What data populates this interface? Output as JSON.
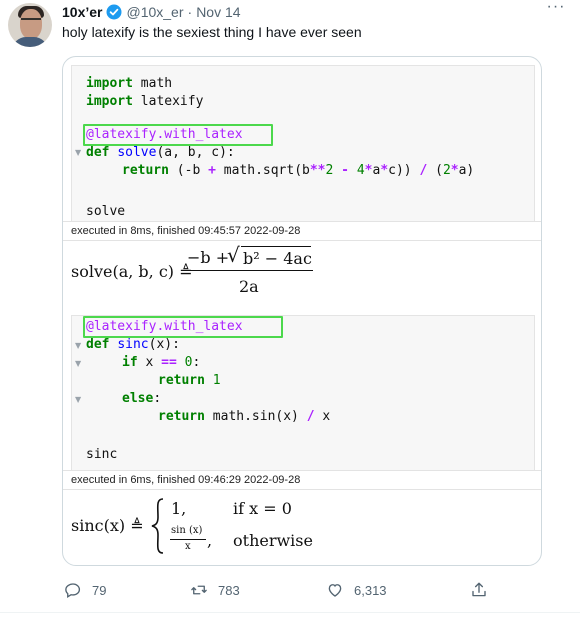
{
  "tweet": {
    "author_name": "10x’er",
    "author_handle": "@10x_er",
    "separator": "·",
    "date": "Nov 14",
    "more_label": "···",
    "text": "holy latexify is the sexiest thing I have ever seen"
  },
  "media": {
    "cell1": {
      "line1_kw": "import",
      "line1_rest": " math",
      "line2_kw": "import",
      "line2_rest": " latexify",
      "decorator": "@latexify.with_latex",
      "def_kw": "def",
      "def_name": "solve",
      "def_rest": "(a, b, c):",
      "return_kw": "return",
      "ret_p1": " (-b ",
      "ret_op1": "+",
      "ret_p2": " math.sqrt(b",
      "ret_op2": "**",
      "ret_num1": "2",
      "ret_op3": " -",
      "ret_num2": " 4",
      "ret_op4": "*",
      "ret_p3": "a",
      "ret_op5": "*",
      "ret_p4": "c)) ",
      "ret_op6": "/",
      "ret_p5": " (",
      "ret_num3": "2",
      "ret_op7": "*",
      "ret_p6": "a)",
      "output_name": "solve",
      "exec_status": "executed in 8ms, finished 09:45:57 2022-09-28"
    },
    "latex1": {
      "lhs": "solve(a, b, c) ≜",
      "numerator": "−b + √b² − 4ac",
      "num_neg_b": "−b +",
      "num_sqrt": "√",
      "num_radicand": "b² − 4ac",
      "denominator": "2a"
    },
    "cell2": {
      "decorator": "@latexify.with_latex",
      "def_kw": "def",
      "def_name": "sinc",
      "def_rest": "(x):",
      "if_kw": "if",
      "if_rest1": " x ",
      "if_op": "==",
      "if_num": " 0",
      "if_rest2": ":",
      "return_kw": "return",
      "ret1_num": " 1",
      "else_kw": "else",
      "else_rest": ":",
      "return2_kw": "return",
      "ret2_rest": " math.sin(x) ",
      "ret2_op": "/",
      "ret2_rest2": " x",
      "output_name": "sinc",
      "exec_status": "executed in 6ms, finished 09:46:29 2022-09-28"
    },
    "latex2": {
      "lhs": "sinc(x) ≜",
      "case1_value": "1,",
      "case1_cond": "if x = 0",
      "case2_num": "sin (x)",
      "case2_den": "x",
      "case2_comma": ",",
      "case2_cond": "otherwise"
    }
  },
  "actions": {
    "reply_count": "79",
    "retweet_count": "783",
    "like_count": "6,313"
  },
  "colors": {
    "verified": "#1d9bf0",
    "decorator_box": "#4cd84c",
    "keyword": "#008000",
    "function_name": "#0000ff",
    "operator": "#aa22ff",
    "secondary_text": "#536471"
  }
}
